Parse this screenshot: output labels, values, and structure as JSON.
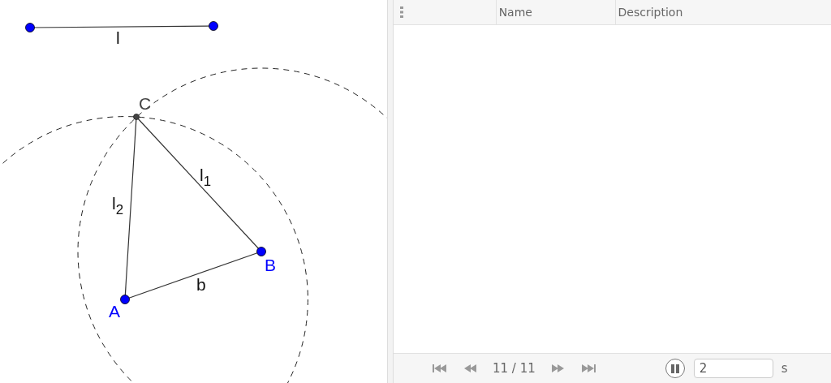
{
  "graphics": {
    "points": [
      {
        "color": "#0000ff"
      },
      {
        "color": "#0000ff"
      },
      {
        "label": "A",
        "color": "#0000ff"
      },
      {
        "label": "B",
        "color": "#0000ff"
      },
      {
        "label": "C",
        "color": "#444444"
      }
    ],
    "segments": [
      {
        "label": "l"
      },
      {
        "label": "b"
      },
      {
        "label": "l$_{1}$"
      },
      {
        "label": "l$_{2}$"
      }
    ],
    "circles": [
      {
        "kind": "dashed"
      },
      {
        "kind": "dashed"
      }
    ]
  },
  "construction_protocol": {
    "columns": [
      "Name",
      "Description"
    ],
    "navigation": {
      "position": "11 / 11",
      "playing": true,
      "interval": "2",
      "unit": "s"
    }
  }
}
